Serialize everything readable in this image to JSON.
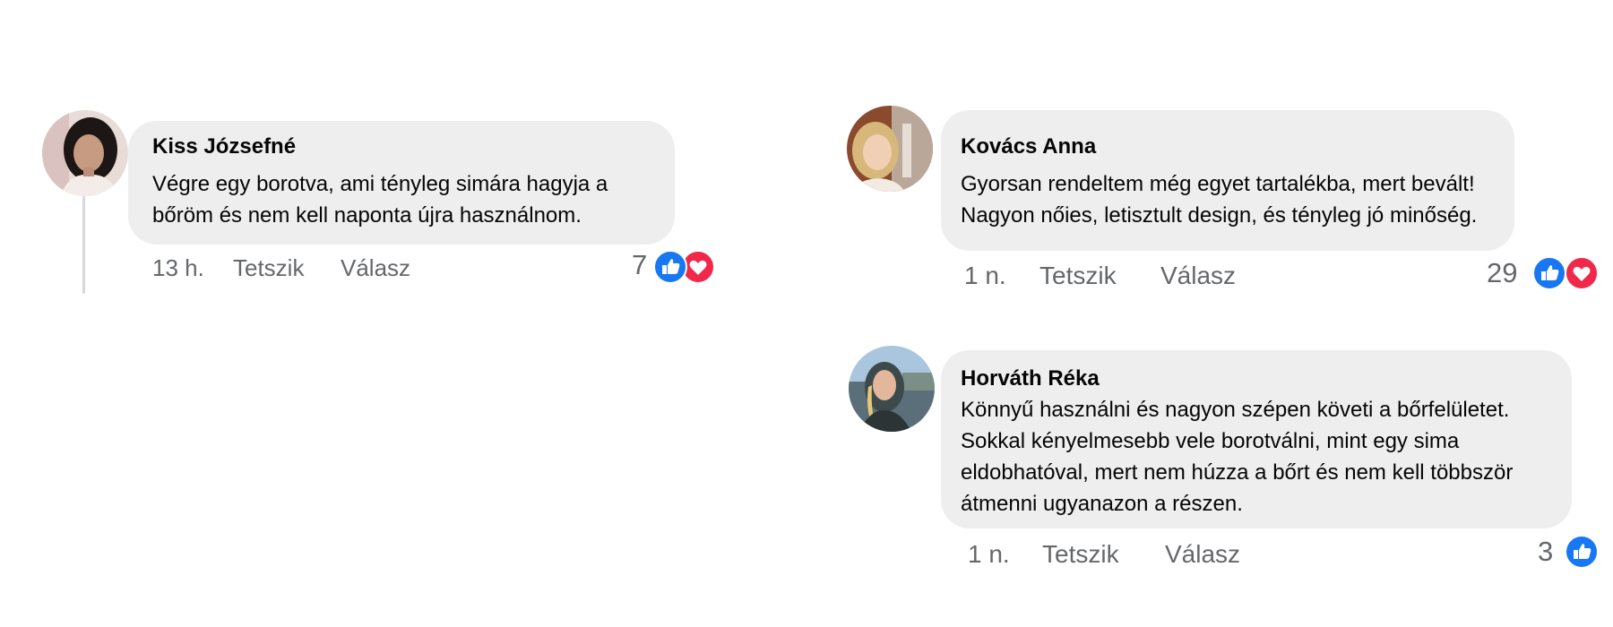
{
  "comments": [
    {
      "author": "Kiss Józsefné",
      "lines": [
        "Végre egy borotva, ami tényleg simára hagyja a",
        "bőröm és nem kell naponta újra használnom."
      ],
      "time": "13 h.",
      "like_label": "Tetszik",
      "reply_label": "Válasz",
      "reaction_count": "7",
      "reactions": [
        "like-icon",
        "love-icon"
      ]
    },
    {
      "author": "Kovács Anna",
      "lines": [
        "Gyorsan rendeltem még egyet tartalékba, mert bevált!",
        "Nagyon nőies, letisztult design, és tényleg jó minőség."
      ],
      "time": "1 n.",
      "like_label": "Tetszik",
      "reply_label": "Válasz",
      "reaction_count": "29",
      "reactions": [
        "like-icon",
        "love-icon"
      ]
    },
    {
      "author": "Horváth Réka",
      "lines": [
        "Könnyű használni és nagyon szépen követi a bőrfelületet.",
        "Sokkal kényelmesebb vele borotválni, mint egy sima",
        "eldobhatóval, mert nem húzza a bőrt és nem kell többször",
        "átmenni ugyanazon a részen."
      ],
      "time": "1 n.",
      "like_label": "Tetszik",
      "reply_label": "Válasz",
      "reaction_count": "3",
      "reactions": [
        "like-icon"
      ]
    }
  ],
  "colors": {
    "bubble": "#eeeeef",
    "meta_text": "#65676b",
    "like_blue": "#1877f2",
    "love_red": "#f02849"
  }
}
